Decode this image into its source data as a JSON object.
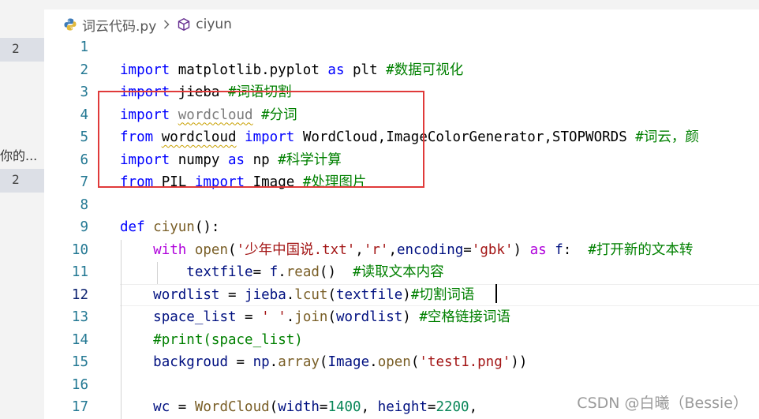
{
  "breadcrumb": {
    "file": "词云代码.py",
    "symbol": "ciyun",
    "file_icon": "python-icon",
    "symbol_icon": "cube-icon",
    "separator_icon": "chevron-right-icon"
  },
  "left_panel": {
    "badges": [
      "2",
      "2"
    ],
    "snippet": "你的..."
  },
  "editor": {
    "line_numbers": [
      "1",
      "2",
      "3",
      "4",
      "5",
      "6",
      "7",
      "8",
      "9",
      "10",
      "11",
      "12",
      "13",
      "14",
      "15",
      "16",
      "17"
    ],
    "active_line": 12,
    "lines": [
      [],
      [
        {
          "t": "import",
          "c": "kw"
        },
        {
          "t": " matplotlib.pyplot "
        },
        {
          "t": "as",
          "c": "kw"
        },
        {
          "t": " plt "
        },
        {
          "t": "#数据可视化",
          "c": "cm"
        }
      ],
      [
        {
          "t": "import",
          "c": "kw"
        },
        {
          "t": " jieba "
        },
        {
          "t": "#词语切割",
          "c": "cm"
        }
      ],
      [
        {
          "t": "import",
          "c": "kw"
        },
        {
          "t": " "
        },
        {
          "t": "wordcloud",
          "c": "faded squig"
        },
        {
          "t": " "
        },
        {
          "t": "#分词",
          "c": "cm"
        }
      ],
      [
        {
          "t": "from",
          "c": "kw"
        },
        {
          "t": " "
        },
        {
          "t": "wordcloud",
          "c": "squig"
        },
        {
          "t": " "
        },
        {
          "t": "import",
          "c": "kw"
        },
        {
          "t": " WordCloud,ImageColorGenerator,STOPWORDS "
        },
        {
          "t": "#词云，颜",
          "c": "cm"
        }
      ],
      [
        {
          "t": "import",
          "c": "kw"
        },
        {
          "t": " numpy "
        },
        {
          "t": "as",
          "c": "kw"
        },
        {
          "t": " np "
        },
        {
          "t": "#科学计算",
          "c": "cm"
        }
      ],
      [
        {
          "t": "from",
          "c": "kw"
        },
        {
          "t": " PIL "
        },
        {
          "t": "import",
          "c": "kw"
        },
        {
          "t": " Image "
        },
        {
          "t": "#处理图片",
          "c": "cm"
        }
      ],
      [],
      [
        {
          "t": "def",
          "c": "kw"
        },
        {
          "t": " "
        },
        {
          "t": "ciyun",
          "c": "fn"
        },
        {
          "t": "():"
        }
      ],
      [
        {
          "t": "    "
        },
        {
          "t": "with",
          "c": "ctl"
        },
        {
          "t": " "
        },
        {
          "t": "open",
          "c": "fn"
        },
        {
          "t": "("
        },
        {
          "t": "'少年中国说.txt'",
          "c": "str"
        },
        {
          "t": ","
        },
        {
          "t": "'r'",
          "c": "str"
        },
        {
          "t": ","
        },
        {
          "t": "encoding",
          "c": "var"
        },
        {
          "t": "="
        },
        {
          "t": "'gbk'",
          "c": "str"
        },
        {
          "t": ") "
        },
        {
          "t": "as",
          "c": "ctl"
        },
        {
          "t": " "
        },
        {
          "t": "f",
          "c": "var"
        },
        {
          "t": ":  "
        },
        {
          "t": "#打开新的文本转",
          "c": "cm"
        }
      ],
      [
        {
          "t": "        "
        },
        {
          "t": "textfile",
          "c": "var"
        },
        {
          "t": "= "
        },
        {
          "t": "f",
          "c": "var"
        },
        {
          "t": "."
        },
        {
          "t": "read",
          "c": "fn"
        },
        {
          "t": "()  "
        },
        {
          "t": "#读取文本内容",
          "c": "cm"
        }
      ],
      [
        {
          "t": "    "
        },
        {
          "t": "wordlist",
          "c": "var"
        },
        {
          "t": " = "
        },
        {
          "t": "jieba",
          "c": "var"
        },
        {
          "t": "."
        },
        {
          "t": "lcut",
          "c": "fn"
        },
        {
          "t": "("
        },
        {
          "t": "textfile",
          "c": "var"
        },
        {
          "t": ")"
        },
        {
          "t": "#切割词语",
          "c": "cm"
        }
      ],
      [
        {
          "t": "    "
        },
        {
          "t": "space_list",
          "c": "var"
        },
        {
          "t": " = "
        },
        {
          "t": "' '",
          "c": "str"
        },
        {
          "t": "."
        },
        {
          "t": "join",
          "c": "fn"
        },
        {
          "t": "("
        },
        {
          "t": "wordlist",
          "c": "var"
        },
        {
          "t": ") "
        },
        {
          "t": "#空格链接词语",
          "c": "cm"
        }
      ],
      [
        {
          "t": "    "
        },
        {
          "t": "#print(space_list)",
          "c": "cm"
        }
      ],
      [
        {
          "t": "    "
        },
        {
          "t": "backgroud",
          "c": "var"
        },
        {
          "t": " = "
        },
        {
          "t": "np",
          "c": "var"
        },
        {
          "t": "."
        },
        {
          "t": "array",
          "c": "fn"
        },
        {
          "t": "("
        },
        {
          "t": "Image",
          "c": "var"
        },
        {
          "t": "."
        },
        {
          "t": "open",
          "c": "fn"
        },
        {
          "t": "("
        },
        {
          "t": "'test1.png'",
          "c": "str"
        },
        {
          "t": "))"
        }
      ],
      [],
      [
        {
          "t": "    "
        },
        {
          "t": "wc",
          "c": "var"
        },
        {
          "t": " = "
        },
        {
          "t": "WordCloud",
          "c": "fn"
        },
        {
          "t": "("
        },
        {
          "t": "width",
          "c": "var"
        },
        {
          "t": "="
        },
        {
          "t": "1400",
          "c": "num"
        },
        {
          "t": ", "
        },
        {
          "t": "height",
          "c": "var"
        },
        {
          "t": "="
        },
        {
          "t": "2200",
          "c": "num"
        },
        {
          "t": ","
        }
      ]
    ]
  },
  "watermark": "CSDN @白曦（Bessie）",
  "colors": {
    "keyword": "#0000ff",
    "comment": "#008000",
    "string": "#a31515",
    "number": "#098658",
    "function": "#795e26",
    "variable": "#001080",
    "control": "#af00db",
    "line_number": "#237893",
    "annotation_box": "#e03a3a"
  }
}
